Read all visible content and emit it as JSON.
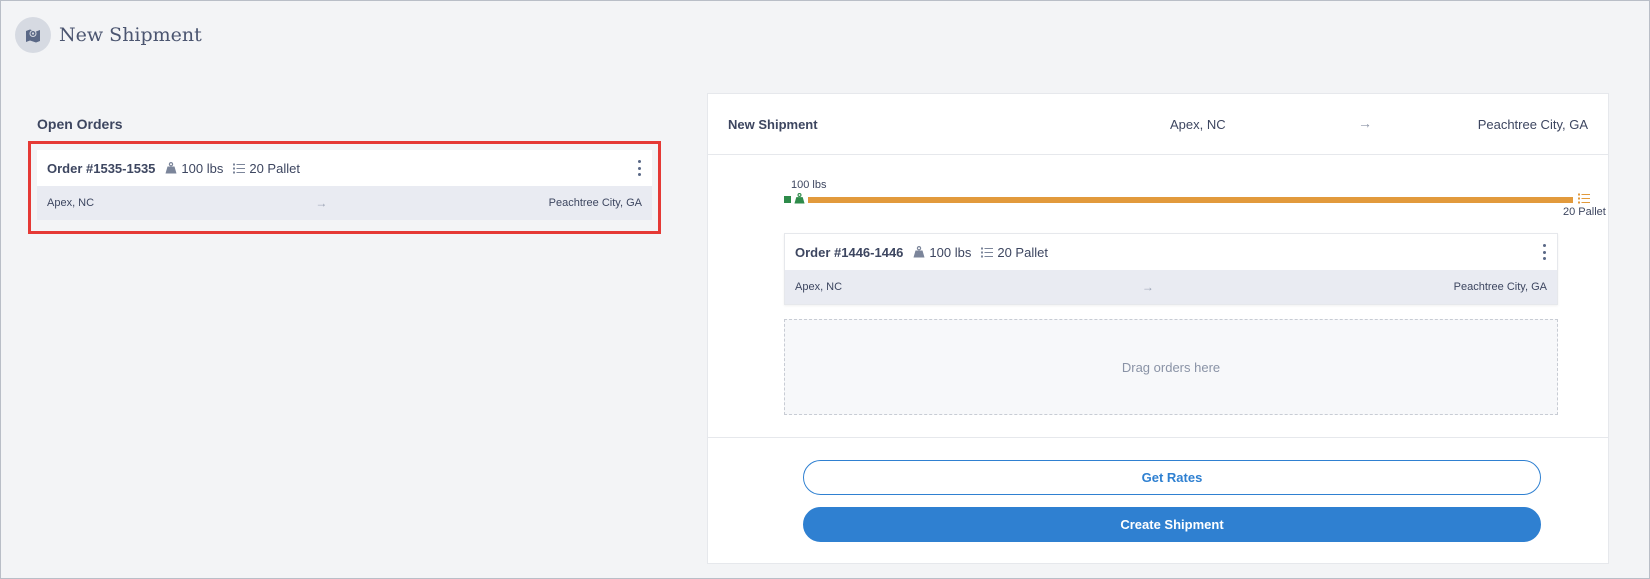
{
  "header": {
    "title": "New Shipment",
    "icon": "map-pin-icon"
  },
  "open_orders": {
    "title": "Open Orders",
    "orders": [
      {
        "id": "Order #1535-1535",
        "weight": "100 lbs",
        "pallets": "20 Pallet",
        "origin": "Apex, NC",
        "destination": "Peachtree City, GA",
        "arrow": "→"
      }
    ]
  },
  "shipment": {
    "title": "New Shipment",
    "origin": "Apex, NC",
    "destination": "Peachtree City, GA",
    "arrow": "→",
    "load": {
      "weight_label": "100 lbs",
      "pallet_label": "20 Pallet",
      "weight_fill_fraction": 0.02,
      "pallet_fill_fraction": 1.0,
      "weight_color": "#2e8b4a",
      "pallet_color": "#e29a3c"
    },
    "orders": [
      {
        "id": "Order #1446-1446",
        "weight": "100 lbs",
        "pallets": "20 Pallet",
        "origin": "Apex, NC",
        "destination": "Peachtree City, GA",
        "arrow": "→"
      }
    ],
    "drop_zone": "Drag orders here",
    "get_rates_label": "Get Rates",
    "create_label": "Create Shipment"
  },
  "colors": {
    "accent": "#2f80d1",
    "highlight": "#e53935"
  }
}
